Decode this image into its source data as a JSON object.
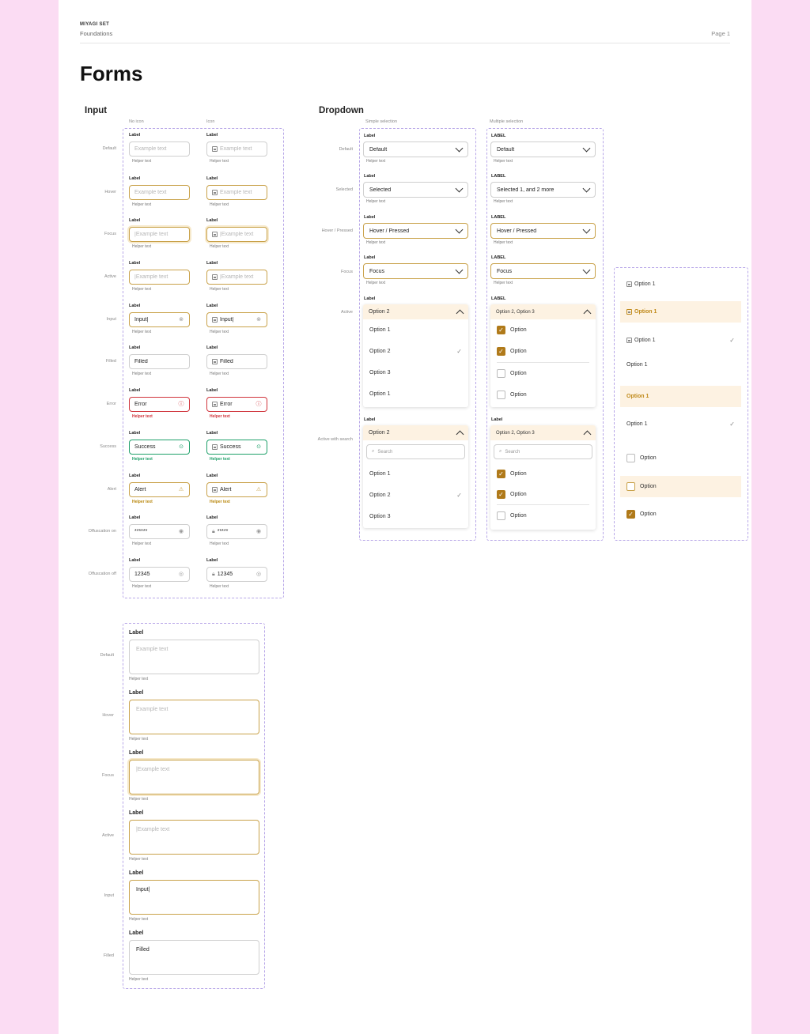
{
  "header": {
    "brand": "MIYAGI SET",
    "subtitle": "Foundations",
    "page": "Page 1"
  },
  "title": "Forms",
  "input_section": {
    "title": "Input",
    "col_no_icon": "No icon",
    "col_icon": "Icon",
    "rows": [
      {
        "state": "Default",
        "label": "Label",
        "text": "Example text",
        "helper": "Helper text"
      },
      {
        "state": "Hover",
        "label": "Label",
        "text": "Example text",
        "helper": "Helper text"
      },
      {
        "state": "Focus",
        "label": "Label",
        "text": "|Example text",
        "helper": "Helper text"
      },
      {
        "state": "Active",
        "label": "Label",
        "text": "|Example text",
        "helper": "Helper text"
      },
      {
        "state": "Input",
        "label": "Label",
        "text": "Input|",
        "helper": "Helper text"
      },
      {
        "state": "Filled",
        "label": "Label",
        "text": "Filled",
        "helper": "Helper text"
      },
      {
        "state": "Error",
        "label": "Label",
        "text": "Error",
        "helper": "Helper text"
      },
      {
        "state": "Success",
        "label": "Label",
        "text": "Success",
        "helper": "Helper text"
      },
      {
        "state": "Alert",
        "label": "Label",
        "text": "Alert",
        "helper": "Helper text"
      },
      {
        "state": "Offuscation on",
        "label": "Label",
        "text": "******",
        "text_icon": "*****",
        "helper": "Helper text"
      },
      {
        "state": "Offuscation off",
        "label": "Label",
        "text": "12345",
        "helper": "Helper text"
      }
    ]
  },
  "dropdown_section": {
    "title": "Dropdown",
    "col_simple": "Simple selection",
    "col_multiple": "Multiple selection",
    "row_labels": [
      "Default",
      "Selected",
      "Hover / Pressed",
      "Focus",
      "Active",
      "Active with search"
    ],
    "simple": {
      "label": "Label",
      "helper": "Helper text",
      "default": "Default",
      "selected": "Selected",
      "hover": "Hover / Pressed",
      "focus": "Focus",
      "active_value": "Option 2",
      "active_options": [
        "Option 1",
        "Option 2",
        "Option 3",
        "Option 1"
      ],
      "search_value": "Option 2",
      "search_placeholder": "Search",
      "search_options": [
        "Option 1",
        "Option 2",
        "Option 3"
      ]
    },
    "multiple": {
      "label": "LABEL",
      "label_search": "Label",
      "helper": "Helper text",
      "default": "Default",
      "selected": "Selected 1, and 2 more",
      "hover": "Hover / Pressed",
      "focus": "Focus",
      "active_value": "Option 2, Option 3",
      "option": "Option",
      "search_placeholder": "Search"
    },
    "items_panel": {
      "option1": "Option 1",
      "option": "Option"
    }
  },
  "textarea_section": {
    "rows": [
      {
        "state": "Default",
        "label": "Label",
        "text": "Example text",
        "helper": "Helper text"
      },
      {
        "state": "Hover",
        "label": "Label",
        "text": "Example text",
        "helper": "Helper text"
      },
      {
        "state": "Focus",
        "label": "Label",
        "text": "|Example text",
        "helper": "Helper text"
      },
      {
        "state": "Active",
        "label": "Label",
        "text": "|Example text",
        "helper": "Helper text"
      },
      {
        "state": "Input",
        "label": "Label",
        "text": "Input|",
        "helper": "Helper text"
      },
      {
        "state": "Filled",
        "label": "Label",
        "text": "Filled",
        "helper": "Helper text"
      }
    ]
  },
  "colors": {
    "background": "#fbdcf3",
    "accent": "#c9a24a",
    "error": "#d0343c",
    "success": "#1fa06a",
    "checkbox": "#b07a1a",
    "highlight": "#fdf2e2"
  }
}
